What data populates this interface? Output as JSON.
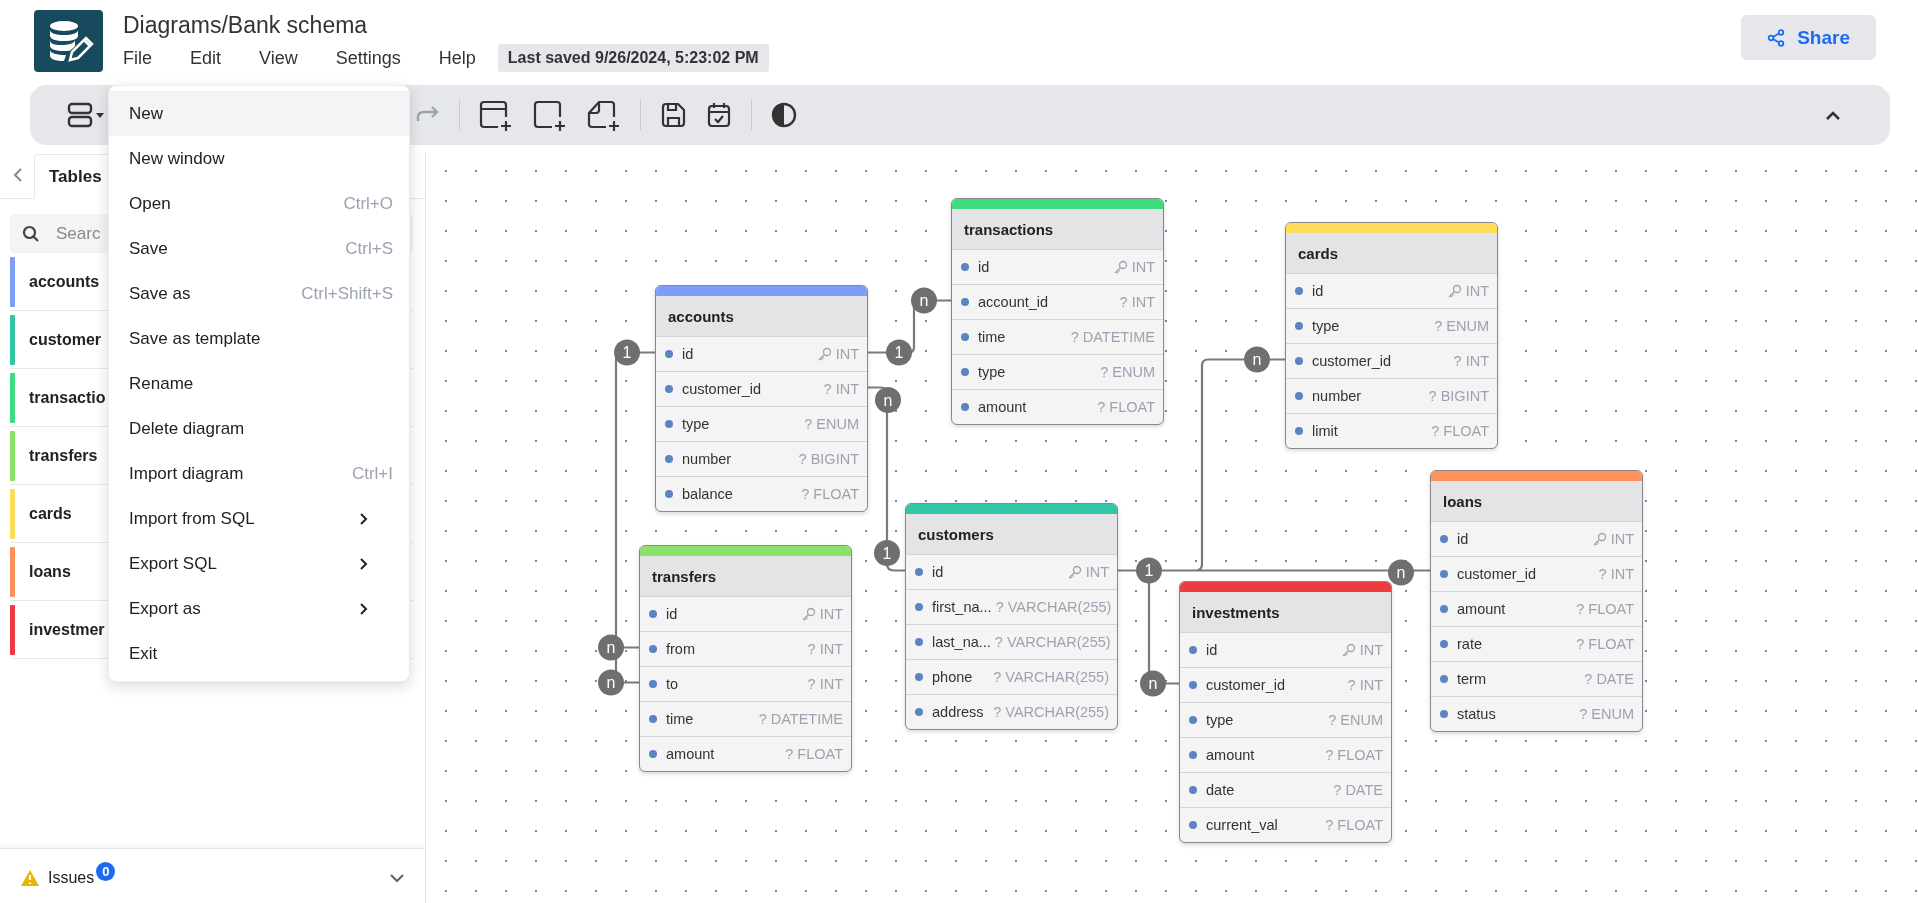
{
  "app": {
    "title": "Diagrams/Bank schema",
    "menu_bar": [
      "File",
      "Edit",
      "View",
      "Settings",
      "Help"
    ],
    "last_saved": "Last saved 9/26/2024, 5:23:02 PM",
    "share_button": "Share"
  },
  "file_menu": [
    {
      "label": "New",
      "kind": "plain",
      "highlighted": true
    },
    {
      "label": "New window",
      "kind": "plain",
      "highlighted": false
    },
    {
      "label": "Open",
      "kind": "shortcut",
      "shortcut": "Ctrl+O",
      "highlighted": false
    },
    {
      "label": "Save",
      "kind": "shortcut",
      "shortcut": "Ctrl+S",
      "highlighted": false
    },
    {
      "label": "Save as",
      "kind": "shortcut",
      "shortcut": "Ctrl+Shift+S",
      "highlighted": false
    },
    {
      "label": "Save as template",
      "kind": "plain",
      "highlighted": false
    },
    {
      "label": "Rename",
      "kind": "plain",
      "highlighted": false
    },
    {
      "label": "Delete diagram",
      "kind": "plain",
      "highlighted": false
    },
    {
      "label": "Import diagram",
      "kind": "shortcut",
      "shortcut": "Ctrl+I",
      "highlighted": false
    },
    {
      "label": "Import from SQL",
      "kind": "submenu",
      "highlighted": false
    },
    {
      "label": "Export SQL",
      "kind": "submenu",
      "highlighted": false
    },
    {
      "label": "Export as",
      "kind": "submenu",
      "highlighted": false
    },
    {
      "label": "Exit",
      "kind": "plain",
      "highlighted": false
    }
  ],
  "sidebar": {
    "tabs": [
      {
        "label": "Tables",
        "selected": true
      }
    ],
    "search": {
      "placeholder": "Searc"
    },
    "tables": [
      {
        "name": "accounts",
        "color": "#7d9df8"
      },
      {
        "name": "customer",
        "color": "#32c6a6"
      },
      {
        "name": "transactio",
        "color": "#3ddc7e"
      },
      {
        "name": "transfers",
        "color": "#8ae26a"
      },
      {
        "name": "cards",
        "color": "#fcdc5a"
      },
      {
        "name": "loans",
        "color": "#ff9159"
      },
      {
        "name": "investmer",
        "color": "#ee3b41"
      }
    ],
    "issues": {
      "label": "Issues",
      "count": "0"
    }
  },
  "diagram": {
    "tables": [
      {
        "name": "accounts",
        "color": "#7d9df8",
        "fields": [
          {
            "name": "id",
            "type": "INT",
            "kind": "primary"
          },
          {
            "name": "customer_id",
            "type": "? INT",
            "kind": "plain"
          },
          {
            "name": "type",
            "type": "? ENUM",
            "kind": "plain"
          },
          {
            "name": "number",
            "type": "? BIGINT",
            "kind": "plain"
          },
          {
            "name": "balance",
            "type": "? FLOAT",
            "kind": "plain"
          }
        ]
      },
      {
        "name": "customers",
        "color": "#32c6a6",
        "fields": [
          {
            "name": "id",
            "type": "INT",
            "kind": "primary"
          },
          {
            "name": "first_na...",
            "type": "? VARCHAR(255)",
            "kind": "plain"
          },
          {
            "name": "last_na...",
            "type": "? VARCHAR(255)",
            "kind": "plain"
          },
          {
            "name": "phone",
            "type": "? VARCHAR(255)",
            "kind": "plain"
          },
          {
            "name": "address",
            "type": "? VARCHAR(255)",
            "kind": "plain"
          }
        ]
      },
      {
        "name": "transactions",
        "color": "#3ddc7e",
        "fields": [
          {
            "name": "id",
            "type": "INT",
            "kind": "primary"
          },
          {
            "name": "account_id",
            "type": "? INT",
            "kind": "plain"
          },
          {
            "name": "time",
            "type": "? DATETIME",
            "kind": "plain"
          },
          {
            "name": "type",
            "type": "? ENUM",
            "kind": "plain"
          },
          {
            "name": "amount",
            "type": "? FLOAT",
            "kind": "plain"
          }
        ]
      },
      {
        "name": "transfers",
        "color": "#8ae26a",
        "fields": [
          {
            "name": "id",
            "type": "INT",
            "kind": "primary"
          },
          {
            "name": "from",
            "type": "? INT",
            "kind": "plain"
          },
          {
            "name": "to",
            "type": "? INT",
            "kind": "plain"
          },
          {
            "name": "time",
            "type": "? DATETIME",
            "kind": "plain"
          },
          {
            "name": "amount",
            "type": "? FLOAT",
            "kind": "plain"
          }
        ]
      },
      {
        "name": "cards",
        "color": "#fcdc5a",
        "fields": [
          {
            "name": "id",
            "type": "INT",
            "kind": "primary"
          },
          {
            "name": "type",
            "type": "? ENUM",
            "kind": "plain"
          },
          {
            "name": "customer_id",
            "type": "? INT",
            "kind": "plain"
          },
          {
            "name": "number",
            "type": "? BIGINT",
            "kind": "plain"
          },
          {
            "name": "limit",
            "type": "? FLOAT",
            "kind": "plain"
          }
        ]
      },
      {
        "name": "loans",
        "color": "#ff9159",
        "fields": [
          {
            "name": "id",
            "type": "INT",
            "kind": "primary"
          },
          {
            "name": "customer_id",
            "type": "? INT",
            "kind": "plain"
          },
          {
            "name": "amount",
            "type": "? FLOAT",
            "kind": "plain"
          },
          {
            "name": "rate",
            "type": "? FLOAT",
            "kind": "plain"
          },
          {
            "name": "term",
            "type": "? DATE",
            "kind": "plain"
          },
          {
            "name": "status",
            "type": "? ENUM",
            "kind": "plain"
          }
        ]
      },
      {
        "name": "investments",
        "color": "#ee3b41",
        "fields": [
          {
            "name": "id",
            "type": "INT",
            "kind": "primary"
          },
          {
            "name": "customer_id",
            "type": "? INT",
            "kind": "plain"
          },
          {
            "name": "type",
            "type": "? ENUM",
            "kind": "plain"
          },
          {
            "name": "amount",
            "type": "? FLOAT",
            "kind": "plain"
          },
          {
            "name": "date",
            "type": "? DATE",
            "kind": "plain"
          },
          {
            "name": "current_val",
            "type": "? FLOAT",
            "kind": "plain"
          }
        ]
      }
    ],
    "connectors": [
      {
        "labels": [
          "1",
          "n"
        ]
      },
      {
        "labels": [
          "n",
          "1"
        ]
      },
      {
        "labels": [
          "1",
          "n",
          "n"
        ]
      },
      {
        "labels": [
          "1",
          "n",
          "n",
          "n"
        ]
      }
    ]
  }
}
